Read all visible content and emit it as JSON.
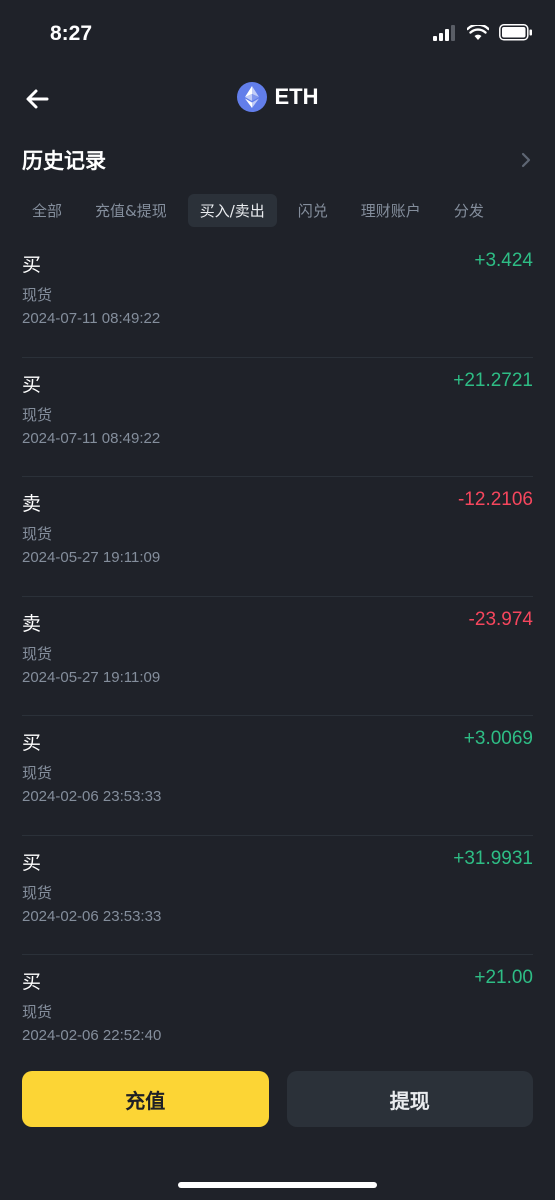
{
  "status": {
    "time": "8:27"
  },
  "nav": {
    "title": "ETH"
  },
  "section": {
    "title": "历史记录"
  },
  "tabs": [
    {
      "label": "全部",
      "active": false
    },
    {
      "label": "充值&提现",
      "active": false
    },
    {
      "label": "买入/卖出",
      "active": true
    },
    {
      "label": "闪兑",
      "active": false
    },
    {
      "label": "理财账户",
      "active": false
    },
    {
      "label": "分发",
      "active": false
    }
  ],
  "records": [
    {
      "type": "买",
      "sub": "现货",
      "time": "2024-07-11 08:49:22",
      "amount": "+3.424",
      "direction": "pos"
    },
    {
      "type": "买",
      "sub": "现货",
      "time": "2024-07-11 08:49:22",
      "amount": "+21.2721",
      "direction": "pos"
    },
    {
      "type": "卖",
      "sub": "现货",
      "time": "2024-05-27 19:11:09",
      "amount": "-12.2106",
      "direction": "neg"
    },
    {
      "type": "卖",
      "sub": "现货",
      "time": "2024-05-27 19:11:09",
      "amount": "-23.974",
      "direction": "neg"
    },
    {
      "type": "买",
      "sub": "现货",
      "time": "2024-02-06 23:53:33",
      "amount": "+3.0069",
      "direction": "pos"
    },
    {
      "type": "买",
      "sub": "现货",
      "time": "2024-02-06 23:53:33",
      "amount": "+31.9931",
      "direction": "pos"
    },
    {
      "type": "买",
      "sub": "现货",
      "time": "2024-02-06 22:52:40",
      "amount": "+21.00",
      "direction": "pos"
    }
  ],
  "actions": {
    "deposit": "充值",
    "withdraw": "提现"
  },
  "colors": {
    "positive": "#2ebd85",
    "negative": "#f6465d",
    "accent": "#fcd535",
    "background": "#1f2229"
  },
  "icons": {
    "back": "arrow-left-icon",
    "coin": "ethereum-icon",
    "more": "chevron-right-icon"
  }
}
